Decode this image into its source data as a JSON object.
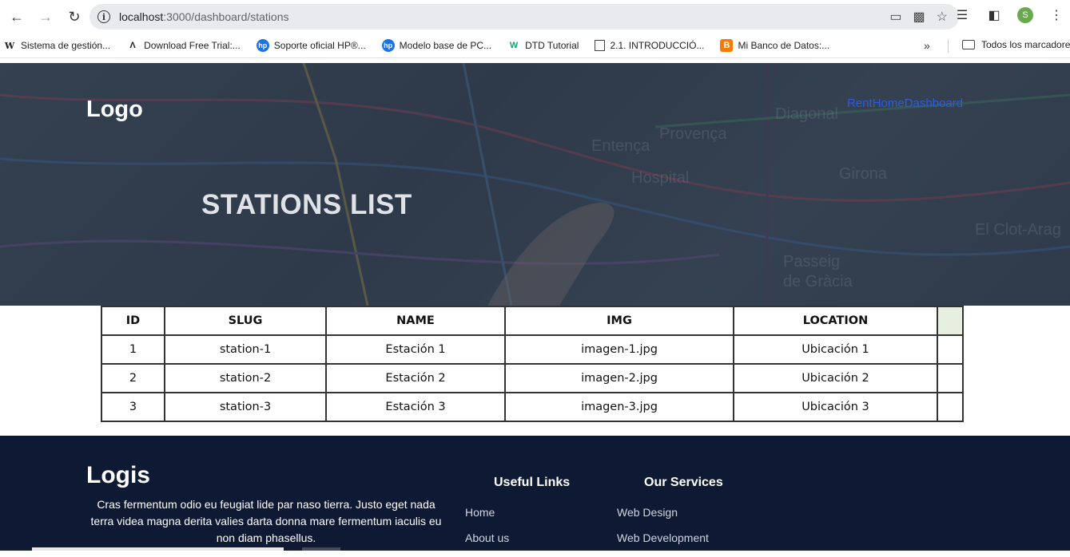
{
  "browser": {
    "url_host": "localhost",
    "url_path": ":3000/dashboard/stations",
    "bookmarks": [
      {
        "icon": "W",
        "label": "Sistema de gestión..."
      },
      {
        "icon": "A",
        "label": "Download Free Trial:..."
      },
      {
        "icon": "hp",
        "label": "Soporte oficial HP®..."
      },
      {
        "icon": "hp",
        "label": "Modelo base de PC..."
      },
      {
        "icon": "W",
        "label": "DTD Tutorial"
      },
      {
        "icon": "doc",
        "label": "2.1. INTRODUCCIÓ..."
      },
      {
        "icon": "B",
        "label": "Mi Banco de Datos:..."
      }
    ],
    "all_bookmarks": "Todos los marcadores",
    "avatar_letter": "S"
  },
  "header": {
    "logo": "Logo",
    "nav": [
      "Rent",
      "Home",
      "Dashboard"
    ],
    "title": "STATIONS LIST"
  },
  "table": {
    "columns": [
      "ID",
      "SLUG",
      "NAME",
      "IMG",
      "LOCATION",
      ""
    ],
    "rows": [
      [
        "1",
        "station-1",
        "Estación 1",
        "imagen-1.jpg",
        "Ubicación 1",
        ""
      ],
      [
        "2",
        "station-2",
        "Estación 2",
        "imagen-2.jpg",
        "Ubicación 2",
        ""
      ],
      [
        "3",
        "station-3",
        "Estación 3",
        "imagen-3.jpg",
        "Ubicación 3",
        ""
      ]
    ]
  },
  "footer": {
    "logo": "Logis",
    "description": "Cras fermentum odio eu feugiat lide par naso tierra. Justo eget nada terra videa magna derita valies darta donna mare fermentum iaculis eu non diam phasellus.",
    "useful_links_title": "Useful Links",
    "useful_links": [
      "Home",
      "About us"
    ],
    "services_title": "Our Services",
    "services": [
      "Web Design",
      "Web Development"
    ]
  },
  "colors": {
    "nav_link": "#2f5be0",
    "footer_bg": "#0e1a33",
    "action_header_bg": "#e6efe0"
  }
}
